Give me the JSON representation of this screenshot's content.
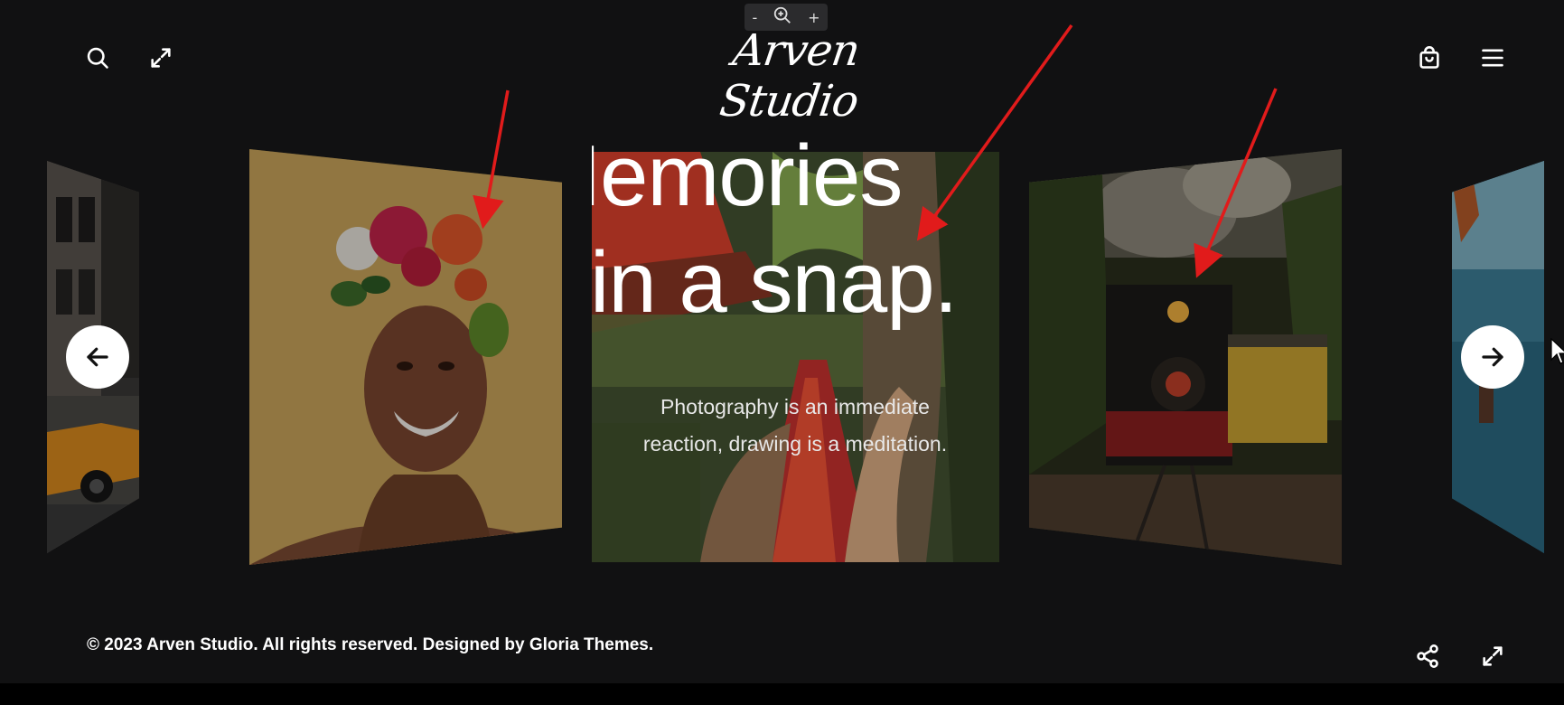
{
  "zoom": {
    "minus": "-",
    "plus": "+"
  },
  "header": {
    "logo_text": "Arven Studio"
  },
  "icons": {
    "search": "search-icon",
    "expand": "expand-icon",
    "cart": "cart-icon",
    "menu": "hamburger-icon",
    "share": "share-icon",
    "fullscreen": "fullscreen-icon"
  },
  "slider": {
    "headline_line1": "Memories",
    "headline_line2": "in a snap.",
    "caption": "Photography is an immediate reaction, drawing is a meditation.",
    "slides": [
      "car-street",
      "woman-flower-crown",
      "hammock-palms",
      "steam-train-forest",
      "ocean-figure"
    ]
  },
  "footer": {
    "copyright": "© 2023 Arven Studio. All rights reserved. Designed by Gloria Themes."
  },
  "colors": {
    "background": "#111112",
    "annotation_arrow": "#e11b1b",
    "text": "#ffffff"
  }
}
